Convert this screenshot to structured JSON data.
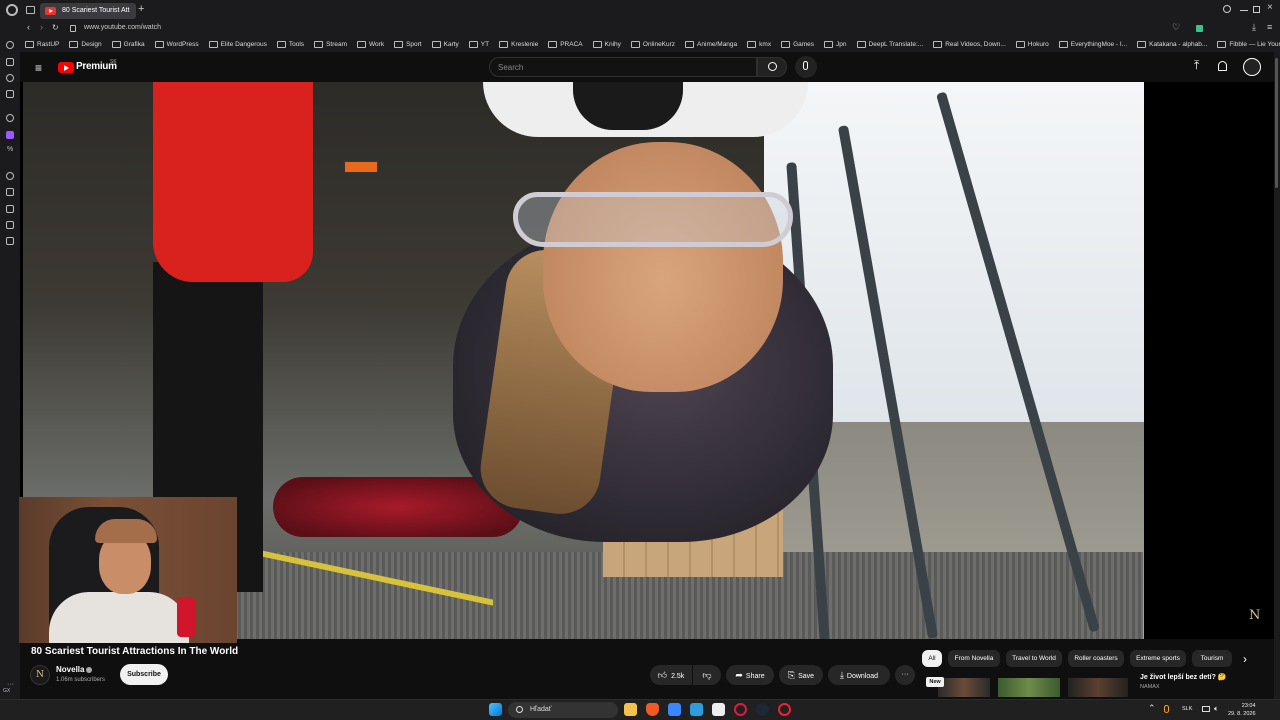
{
  "browser": {
    "tab_title": "80 Scariest Tourist Att",
    "url": "www.youtube.com/watch",
    "bookmarks": [
      "RastUP",
      "Design",
      "Grafika",
      "WordPress",
      "Elite Dangerous",
      "Tools",
      "Stream",
      "Work",
      "Sport",
      "Karty",
      "YT",
      "Kreslenie",
      "PRACA",
      "Knihy",
      "OnlineKurz",
      "Anime/Manga",
      "kmx",
      "Games",
      "Jpn",
      "DeepL Translate:...",
      "Real Videos, Down...",
      "Hokuro",
      "EverythingMoe - I...",
      "Katakana - alphab...",
      "Fibble — Lie Your..."
    ]
  },
  "youtube": {
    "brand": "Premium",
    "region": "SK",
    "search_placeholder": "Search",
    "video_title": "80 Scariest Tourist Attractions In The World",
    "channel_name": "Novella",
    "channel_initial": "N",
    "subscribers": "1.06m subscribers",
    "subscribe_label": "Subscribe",
    "likes": "2.5k",
    "share_label": "Share",
    "save_label": "Save",
    "download_label": "Download",
    "more_label": "···",
    "watermark": "N",
    "chips": [
      "All",
      "From Novella",
      "Travel to World",
      "Roller coasters",
      "Extreme sports",
      "Tourism"
    ],
    "rec": {
      "badge": "New",
      "title": "Je život lepší bez detí? 🤔",
      "channel": "NAMAX"
    }
  },
  "taskbar": {
    "search_placeholder": "Hľadať",
    "lang": "SLK",
    "time": "23:04",
    "date": "29. 8. 2026"
  },
  "sidebar_label": "GX",
  "colors": {
    "accent_red": "#ff0000",
    "background": "#0f0f0f",
    "pill": "#272727"
  }
}
